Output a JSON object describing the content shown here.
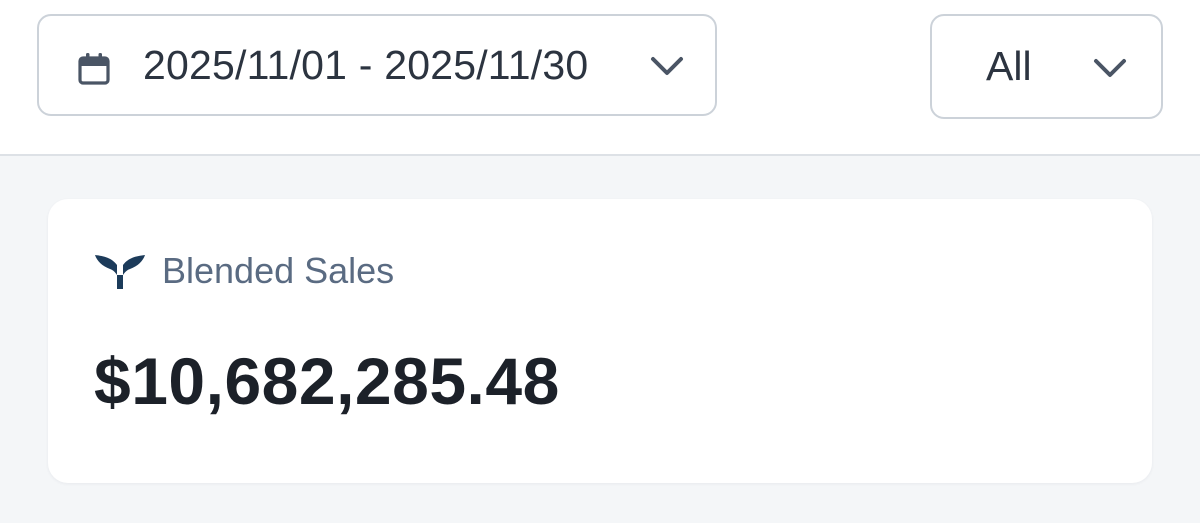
{
  "date_filter": {
    "range_label": "2025/11/01 - 2025/11/30",
    "icon": "calendar-icon",
    "dropdown_icon": "chevron-down-icon"
  },
  "segment_filter": {
    "selected": "All",
    "dropdown_icon": "chevron-down-icon"
  },
  "metric_card": {
    "icon": "whale-tail-logo-icon",
    "label": "Blended Sales",
    "value": "$10,682,285.48"
  },
  "colors": {
    "brand_icon": "#1c3b5a",
    "label": "#5a6b82",
    "value": "#1c2129",
    "border": "#ccd2d9",
    "page_background": "#f4f6f8"
  }
}
